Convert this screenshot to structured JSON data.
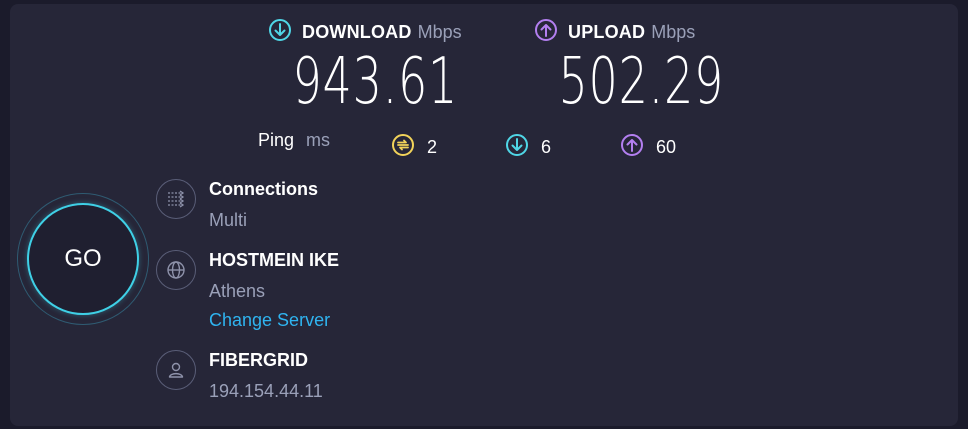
{
  "download": {
    "label": "DOWNLOAD",
    "unit": "Mbps",
    "value": "943.61",
    "icon": "arrow-down-circle-icon",
    "color": "#4fd6e6"
  },
  "upload": {
    "label": "UPLOAD",
    "unit": "Mbps",
    "value": "502.29",
    "icon": "arrow-up-circle-icon",
    "color": "#b37ff0"
  },
  "ping": {
    "label": "Ping",
    "unit": "ms",
    "idle": {
      "value": "2",
      "icon": "ping-idle-icon",
      "color": "#f2d35a"
    },
    "download": {
      "value": "6",
      "icon": "arrow-down-circle-icon",
      "color": "#4fd6e6"
    },
    "upload": {
      "value": "60",
      "icon": "arrow-up-circle-icon",
      "color": "#b37ff0"
    }
  },
  "go_button": {
    "label": "GO",
    "accent": "#3fd0e6"
  },
  "connections": {
    "title": "Connections",
    "value": "Multi",
    "icon": "connections-arrows-icon"
  },
  "server": {
    "title": "HOSTMEIN IKE",
    "location": "Athens",
    "change_label": "Change Server",
    "icon": "globe-icon"
  },
  "provider": {
    "title": "FIBERGRID",
    "ip": "194.154.44.11",
    "icon": "user-icon"
  }
}
